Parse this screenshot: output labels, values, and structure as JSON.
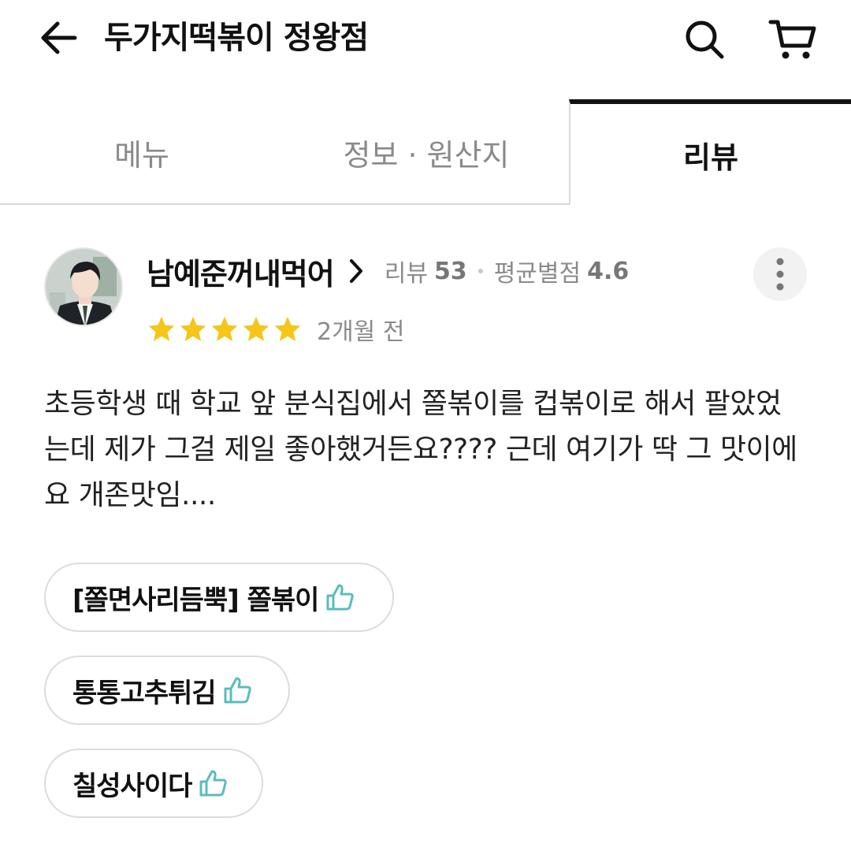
{
  "header": {
    "title": "두가지떡볶이 정왕점",
    "back_icon": "arrow-left-icon",
    "search_icon": "search-icon",
    "cart_icon": "cart-icon"
  },
  "tabs": [
    {
      "label": "메뉴",
      "active": false
    },
    {
      "label": "정보 · 원산지",
      "active": false
    },
    {
      "label": "리뷰",
      "active": true
    }
  ],
  "review": {
    "reviewer_name": "남예준꺼내먹어",
    "review_label": "리뷰",
    "review_count": "53",
    "avg_label": "평균별점",
    "avg_rating": "4.6",
    "stars": 5,
    "time_ago": "2개월 전",
    "text": "초등학생 때 학교 앞 분식집에서 쫄볶이를 컵볶이로 해서 팔았었는데 제가 그걸 제일 좋아했거든요???? 근데 여기가 딱 그 맛이에요 개존맛임....",
    "liked_items": [
      {
        "label": "[쫄면사리듬뿍] 쫄볶이"
      },
      {
        "label": "통통고추튀김"
      },
      {
        "label": "칠성사이다"
      }
    ]
  },
  "colors": {
    "star": "#f5c518",
    "thumb": "#5bbcbc",
    "active_tab_border": "#111111",
    "muted_text": "#8a8a8a"
  }
}
